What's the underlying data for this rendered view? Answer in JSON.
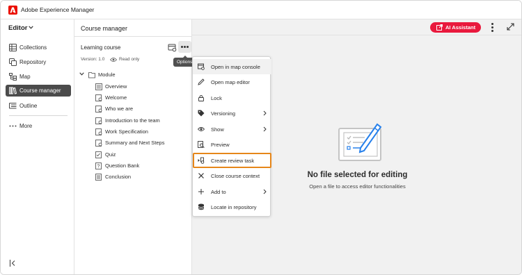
{
  "app": {
    "title": "Adobe Experience Manager"
  },
  "leftnav": {
    "mode": "Editor",
    "items": [
      {
        "label": "Collections",
        "icon": "collections-icon",
        "active": false
      },
      {
        "label": "Repository",
        "icon": "repository-icon",
        "active": false
      },
      {
        "label": "Map",
        "icon": "map-icon",
        "active": false
      },
      {
        "label": "Course manager",
        "icon": "course-manager-icon",
        "active": true
      },
      {
        "label": "Outline",
        "icon": "outline-icon",
        "active": false
      }
    ],
    "more": "More"
  },
  "course_panel": {
    "title": "Course manager",
    "course_name": "Learning course",
    "version": "Version: 1.0",
    "read_only": "Read only",
    "tooltip": "Options",
    "tree": {
      "root": "Module",
      "children": [
        {
          "label": "Overview",
          "icon": "overview-icon"
        },
        {
          "label": "Welcome",
          "icon": "topic-icon"
        },
        {
          "label": "Who we are",
          "icon": "topic-icon"
        },
        {
          "label": "Introduction to the team",
          "icon": "topic-icon"
        },
        {
          "label": "Work Specification",
          "icon": "topic-icon"
        },
        {
          "label": "Summary and Next Steps",
          "icon": "topic-icon"
        },
        {
          "label": "Quiz",
          "icon": "quiz-icon"
        },
        {
          "label": "Question Bank",
          "icon": "question-bank-icon"
        },
        {
          "label": "Conclusion",
          "icon": "topic-icon"
        }
      ]
    }
  },
  "options_menu": {
    "items": [
      {
        "label": "Open in map console",
        "icon": "map-console-icon",
        "submenu": false
      },
      {
        "label": "Open map editor",
        "icon": "pencil-icon",
        "submenu": false
      },
      {
        "label": "Lock",
        "icon": "lock-icon",
        "submenu": false
      },
      {
        "label": "Versioning",
        "icon": "tag-icon",
        "submenu": true
      },
      {
        "label": "Show",
        "icon": "eye-icon",
        "submenu": true
      },
      {
        "label": "Preview",
        "icon": "preview-icon",
        "submenu": false
      },
      {
        "label": "Create review task",
        "icon": "review-task-icon",
        "submenu": false
      },
      {
        "label": "Close course context",
        "icon": "close-icon",
        "submenu": false
      },
      {
        "label": "Add to",
        "icon": "plus-icon",
        "submenu": true
      },
      {
        "label": "Locate in repository",
        "icon": "database-icon",
        "submenu": false
      }
    ]
  },
  "content": {
    "ai_button": "AI Assistant",
    "empty_title": "No file selected for editing",
    "empty_subtitle": "Open a file to access editor functionalities"
  },
  "colors": {
    "brand": "#eb1000",
    "ai_button": "#e9193d",
    "active_nav": "#4b4b4b",
    "focus_ring": "#e68619",
    "accent_blue": "#2680eb"
  }
}
